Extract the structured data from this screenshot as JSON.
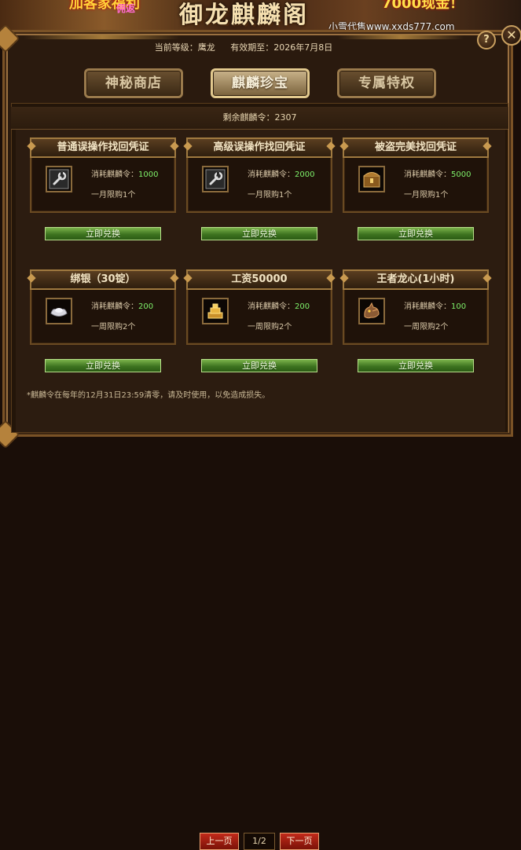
{
  "banner": {
    "left_text": "加客家福利",
    "left_sub": "佣返",
    "title": "御龙麒麟阁",
    "right_text": "7000现金！",
    "watermark": "小雪代售www.xxds777.com"
  },
  "controls": {
    "help": "?",
    "close": "✕"
  },
  "header": {
    "level": "当前等级：鹰龙",
    "validity": "有效期至：2026年7月8日"
  },
  "tabs": [
    {
      "label": "神秘商店",
      "active": false
    },
    {
      "label": "麒麟珍宝",
      "active": true
    },
    {
      "label": "专属特权",
      "active": false
    }
  ],
  "remaining": "剩余麒麟令：2307",
  "cost_prefix": "消耗麒麟令：",
  "items": [
    {
      "name": "普通误操作找回凭证",
      "cost": "1000",
      "limit": "一月限购1个",
      "icon": "wrench-icon"
    },
    {
      "name": "高级误操作找回凭证",
      "cost": "2000",
      "limit": "一月限购1个",
      "icon": "wrench-icon"
    },
    {
      "name": "被盗完美找回凭证",
      "cost": "5000",
      "limit": "一月限购1个",
      "icon": "treasure-box-icon"
    },
    {
      "name": "绑银（30锭）",
      "cost": "200",
      "limit": "一周限购2个",
      "icon": "silver-ingot-icon"
    },
    {
      "name": "工资50000",
      "cost": "200",
      "limit": "一周限购2个",
      "icon": "gold-ingot-icon"
    },
    {
      "name": "王者龙心(1小时)",
      "cost": "100",
      "limit": "一周限购2个",
      "icon": "dragon-heart-icon"
    }
  ],
  "redeem_label": "立即兑换",
  "note": "*麒麟令在每年的12月31日23:59清零，请及时使用，以免造成损失。",
  "pager": {
    "prev": "上一页",
    "page": "1/2",
    "next": "下一页"
  },
  "colors": {
    "accent_green": "#7ef06a",
    "button_red": "#c22a1a",
    "frame_gold": "#9a7040"
  }
}
